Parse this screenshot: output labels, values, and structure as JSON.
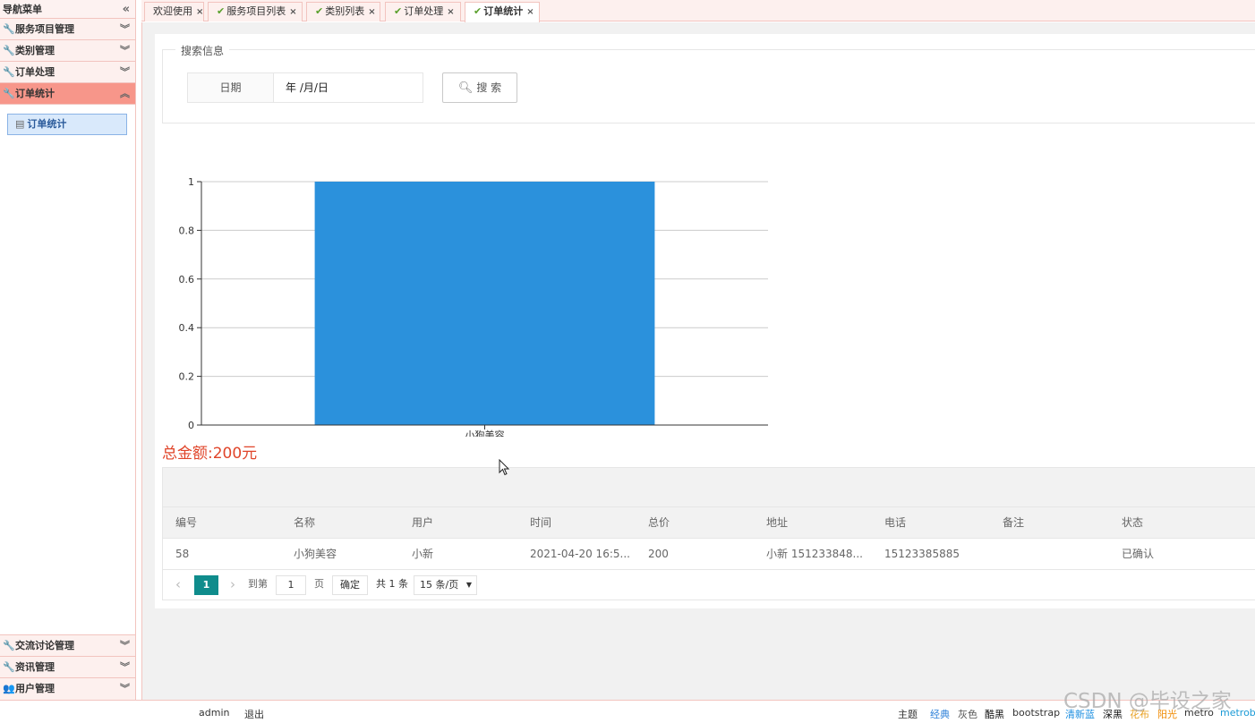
{
  "sidebar": {
    "header": "导航菜单",
    "collapse_icon": "«",
    "groups": [
      {
        "label": "服务项目管理"
      },
      {
        "label": "类别管理"
      },
      {
        "label": "订单处理"
      },
      {
        "label": "订单统计"
      }
    ],
    "active_sub": "订单统计",
    "bottom_groups": [
      {
        "label": "交流讨论管理"
      },
      {
        "label": "资讯管理"
      },
      {
        "label": "用户管理"
      }
    ]
  },
  "tabs": [
    {
      "label": "欢迎使用",
      "icon": ""
    },
    {
      "label": "服务项目列表",
      "icon": "check-icon"
    },
    {
      "label": "类别列表",
      "icon": "check-icon"
    },
    {
      "label": "订单处理",
      "icon": "check-icon"
    },
    {
      "label": "订单统计",
      "icon": "check-icon",
      "active": true
    }
  ],
  "search": {
    "legend": "搜索信息",
    "date_label": "日期",
    "date_value": "年 /月/日",
    "button_label": "搜 索"
  },
  "chart_data": {
    "type": "bar",
    "categories": [
      "小狗美容"
    ],
    "values": [
      1
    ],
    "ylim": [
      0,
      1
    ],
    "yticks": [
      "0",
      "0.2",
      "0.4",
      "0.6",
      "0.8",
      "1"
    ],
    "grid": true,
    "bar_color": "#2b91dc",
    "legend": "none"
  },
  "total_text": "总金额:200元",
  "table": {
    "headers": [
      "编号",
      "名称",
      "用户",
      "时间",
      "总价",
      "地址",
      "电话",
      "备注",
      "状态"
    ],
    "rows": [
      [
        "58",
        "小狗美容",
        "小新",
        "2021-04-20 16:5...",
        "200",
        "小新 151233848...",
        "15123385885",
        "",
        "已确认"
      ]
    ]
  },
  "pager": {
    "prev": "‹",
    "current": "1",
    "next": "›",
    "goto_label": "到第",
    "goto_value": "1",
    "page_unit": "页",
    "confirm": "确定",
    "total": "共 1 条",
    "page_size": "15 条/页"
  },
  "footer": {
    "user": "admin",
    "logout": "退出",
    "theme_label": "主题",
    "themes": [
      {
        "label": "经典",
        "color": "#2b7fd8"
      },
      {
        "label": "灰色",
        "color": "#555555"
      },
      {
        "label": "酷黑",
        "color": "#111111"
      },
      {
        "label": "bootstrap",
        "color": "#333333"
      },
      {
        "label": "清新蓝",
        "color": "#1d8fe0"
      },
      {
        "label": "深黑",
        "color": "#111111"
      },
      {
        "label": "花布",
        "color": "#e8a020"
      },
      {
        "label": "阳光",
        "color": "#f08a00"
      },
      {
        "label": "metro",
        "color": "#333333"
      },
      {
        "label": "metroblue",
        "color": "#1a9ad6"
      }
    ]
  },
  "watermark": "CSDN @毕设之家"
}
